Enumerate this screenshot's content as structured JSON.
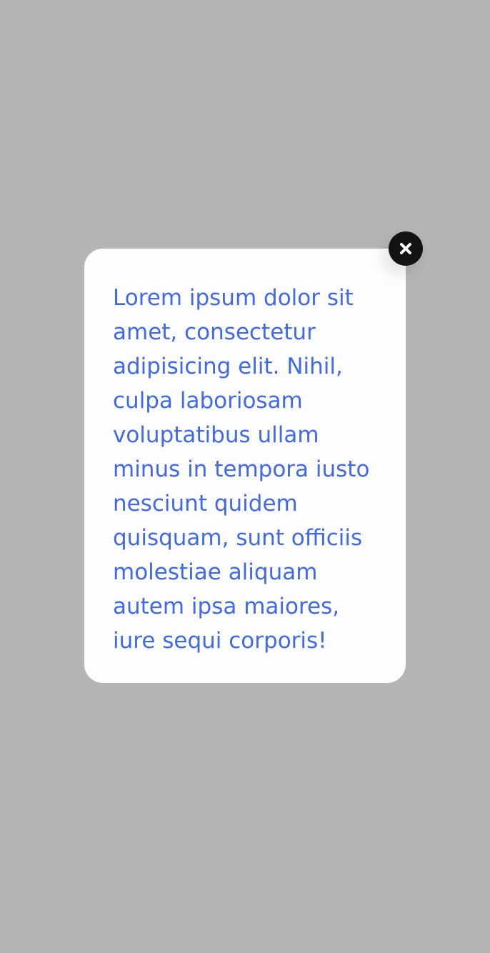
{
  "modal": {
    "text": "Lorem ipsum dolor sit amet, consectetur adipisicing elit. Nihil, culpa laboriosam voluptatibus ullam minus in tempora iusto nesciunt quidem quisquam, sunt officiis molestiae aliquam autem ipsa maiores, iure sequi corporis!",
    "close_icon": "close-icon"
  },
  "colors": {
    "backdrop": "#b5b5b5",
    "modal_background": "#fdfdfd",
    "text": "#4169e8",
    "close_button": "#131313",
    "close_glyph": "#ffffff"
  }
}
